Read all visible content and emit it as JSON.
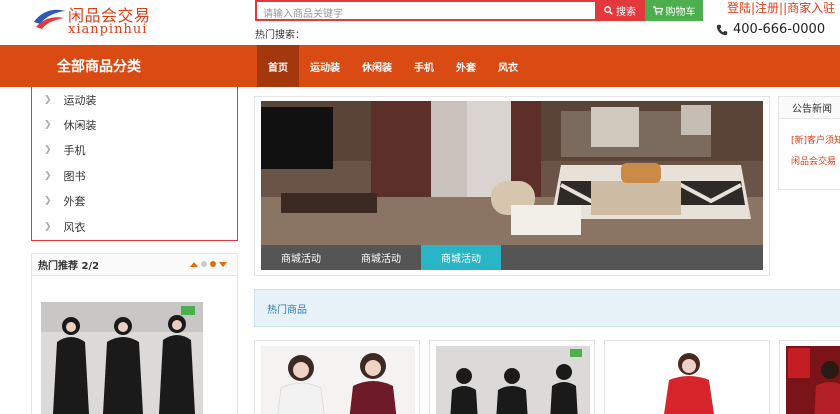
{
  "logo": {
    "name_cn": "闲品会交易",
    "name_en": "xianpinhui",
    "icon": "swoosh-logo-icon"
  },
  "search": {
    "placeholder": "请输入商品关键字",
    "button_label": "搜索",
    "search_icon": "search-icon"
  },
  "cart": {
    "label": "购物车",
    "icon": "cart-icon"
  },
  "hot_search": {
    "label": "热门搜索："
  },
  "top_links": {
    "text": "登陆|注册||商家入驻"
  },
  "phone": {
    "number": "400-666-0000",
    "icon": "phone-icon"
  },
  "nav": {
    "all_categories": "全部商品分类",
    "items": [
      {
        "label": "首页",
        "active": true
      },
      {
        "label": "运动装",
        "active": false
      },
      {
        "label": "休闲装",
        "active": false
      },
      {
        "label": "手机",
        "active": false
      },
      {
        "label": "外套",
        "active": false
      },
      {
        "label": "风衣",
        "active": false
      }
    ]
  },
  "categories": [
    {
      "label": "运动装"
    },
    {
      "label": "休闲装"
    },
    {
      "label": "手机"
    },
    {
      "label": "图书"
    },
    {
      "label": "外套"
    },
    {
      "label": "风衣"
    }
  ],
  "hot_recommend": {
    "title": "热门推荐 2/2"
  },
  "banner": {
    "tabs": [
      {
        "label": "商城活动",
        "active": false
      },
      {
        "label": "商城活动",
        "active": false
      },
      {
        "label": "商城活动",
        "active": true
      }
    ]
  },
  "notice": {
    "title": "公告新闻",
    "items": [
      {
        "text": "[新]客户须知"
      },
      {
        "text": "闲品会交易"
      }
    ]
  },
  "hot_products": {
    "title": "热门商品"
  },
  "colors": {
    "brand": "#d94b12",
    "accent_red": "#e4393c",
    "cart_green": "#4cae4c",
    "tab_active": "#2ab5c6"
  }
}
